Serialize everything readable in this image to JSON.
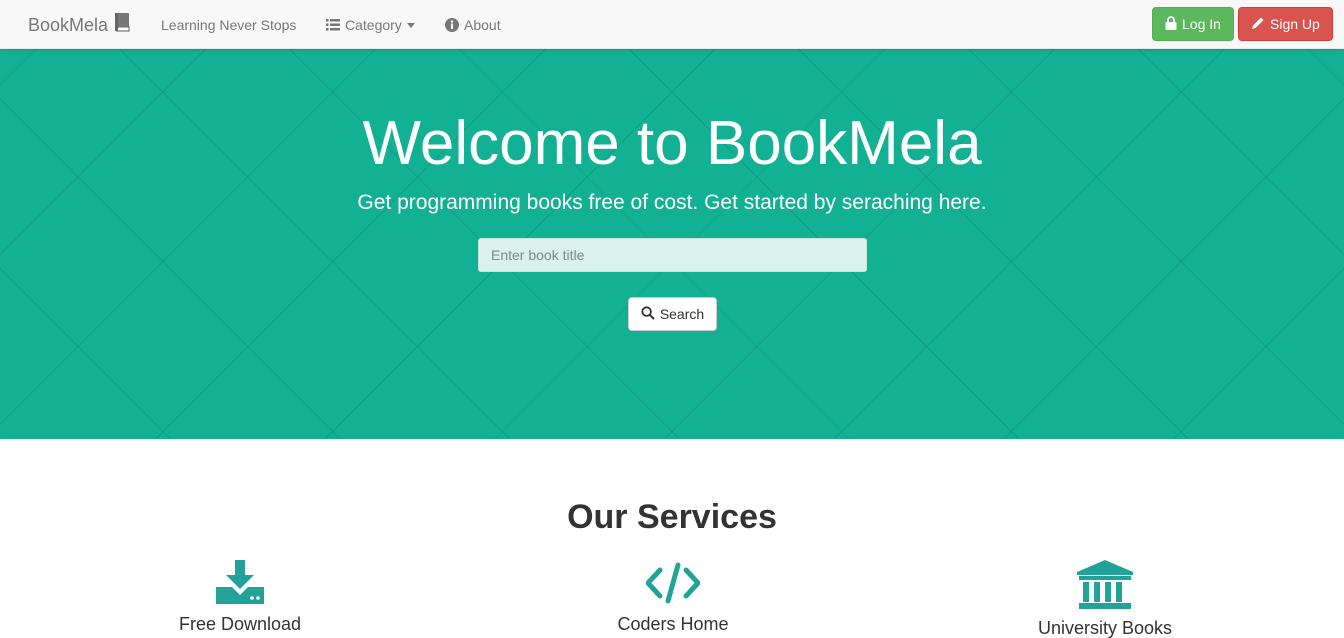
{
  "navbar": {
    "brand": "BookMela",
    "links": [
      {
        "label": "Learning Never Stops"
      },
      {
        "label": "Category"
      },
      {
        "label": "About"
      }
    ],
    "login_label": "Log In",
    "signup_label": "Sign Up",
    "colors": {
      "login": "#5cb85c",
      "signup": "#d9534f"
    }
  },
  "hero": {
    "title": "Welcome to BookMela",
    "subtitle": "Get programming books free of cost. Get started by seraching here.",
    "search_placeholder": "Enter book title",
    "search_label": "Search",
    "background_color": "#12b193"
  },
  "services": {
    "title": "Our Services",
    "accent_color": "#22a39a",
    "items": [
      {
        "label": "Free Download",
        "icon": "download-icon"
      },
      {
        "label": "Coders Home",
        "icon": "code-icon"
      },
      {
        "label": "University Books",
        "icon": "university-icon"
      }
    ]
  }
}
